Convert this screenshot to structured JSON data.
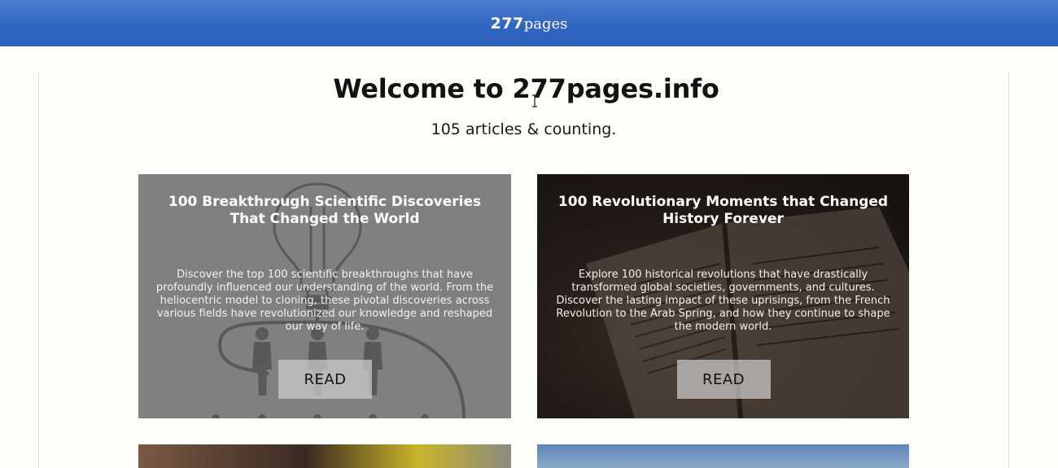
{
  "header": {
    "brand_number": "277",
    "brand_word": "pages"
  },
  "main": {
    "title": "Welcome to 277pages.info",
    "subtitle": "105 articles & counting."
  },
  "cards": [
    {
      "title": "100 Breakthrough Scientific Discoveries That Changed the World",
      "description": "Discover the top 100 scientific breakthroughs that have profoundly influenced our understanding of the world. From the heliocentric model to cloning, these pivotal discoveries across various fields have revolutionized our knowledge and reshaped our way of life.",
      "button": "READ",
      "image_icon": "lightbulb-people-icon"
    },
    {
      "title": "100 Revolutionary Moments that Changed History Forever",
      "description": "Explore 100 historical revolutions that have drastically transformed global societies, governments, and cultures. Discover the lasting impact of these uprisings, from the French Revolution to the Arab Spring, and how they continue to shape the modern world.",
      "button": "READ",
      "image_icon": "open-book-icon"
    }
  ],
  "colors": {
    "header": "#2f64c0",
    "background": "#fdfef9"
  }
}
